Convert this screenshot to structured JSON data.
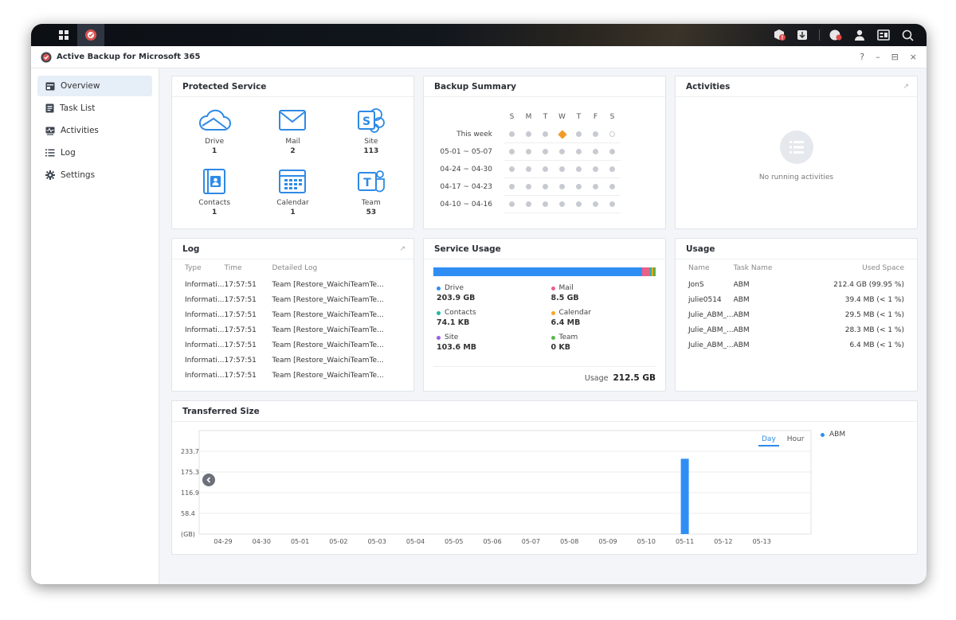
{
  "app": {
    "title": "Active Backup for Microsoft 365"
  },
  "window_controls": {
    "help": "?",
    "minimize": "–",
    "restore": "⊟",
    "close": "×"
  },
  "sidebar": {
    "items": [
      {
        "label": "Overview",
        "icon": "overview-icon"
      },
      {
        "label": "Task List",
        "icon": "task-list-icon"
      },
      {
        "label": "Activities",
        "icon": "activities-icon"
      },
      {
        "label": "Log",
        "icon": "log-icon"
      },
      {
        "label": "Settings",
        "icon": "gear-icon"
      }
    ]
  },
  "protected_service": {
    "title": "Protected Service",
    "items": [
      {
        "name": "Drive",
        "count": "1"
      },
      {
        "name": "Mail",
        "count": "2"
      },
      {
        "name": "Site",
        "count": "113"
      },
      {
        "name": "Contacts",
        "count": "1"
      },
      {
        "name": "Calendar",
        "count": "1"
      },
      {
        "name": "Team",
        "count": "53"
      }
    ]
  },
  "backup_summary": {
    "title": "Backup Summary",
    "days": [
      "S",
      "M",
      "T",
      "W",
      "T",
      "F",
      "S"
    ],
    "weeks": [
      {
        "label": "This week",
        "status": [
          "gray",
          "gray",
          "gray",
          "warning",
          "gray",
          "gray",
          "empty"
        ]
      },
      {
        "label": "05-01 ~ 05-07",
        "status": [
          "gray",
          "gray",
          "gray",
          "gray",
          "gray",
          "gray",
          "gray"
        ]
      },
      {
        "label": "04-24 ~ 04-30",
        "status": [
          "gray",
          "gray",
          "gray",
          "gray",
          "gray",
          "gray",
          "gray"
        ]
      },
      {
        "label": "04-17 ~ 04-23",
        "status": [
          "gray",
          "gray",
          "gray",
          "gray",
          "gray",
          "gray",
          "gray"
        ]
      },
      {
        "label": "04-10 ~ 04-16",
        "status": [
          "gray",
          "gray",
          "gray",
          "gray",
          "gray",
          "gray",
          "gray"
        ]
      }
    ]
  },
  "activities": {
    "title": "Activities",
    "empty_text": "No running activities"
  },
  "log": {
    "title": "Log",
    "columns": [
      "Type",
      "Time",
      "Detailed Log"
    ],
    "rows": [
      [
        "Informati...",
        "17:57:51",
        "Team [Restore_WaichiTeamTe..."
      ],
      [
        "Informati...",
        "17:57:51",
        "Team [Restore_WaichiTeamTe..."
      ],
      [
        "Informati...",
        "17:57:51",
        "Team [Restore_WaichiTeamTe..."
      ],
      [
        "Informati...",
        "17:57:51",
        "Team [Restore_WaichiTeamTe..."
      ],
      [
        "Informati...",
        "17:57:51",
        "Team [Restore_WaichiTeamTe..."
      ],
      [
        "Informati...",
        "17:57:51",
        "Team [Restore_WaichiTeamTe..."
      ],
      [
        "Informati...",
        "17:57:51",
        "Team [Restore_WaichiTeamTe..."
      ]
    ]
  },
  "service_usage": {
    "title": "Service Usage",
    "items": [
      {
        "name": "Drive",
        "value": "203.9 GB",
        "color": "#2f8ef4",
        "share": 0.9596
      },
      {
        "name": "Mail",
        "value": "8.5 GB",
        "color": "#ec5f87",
        "share": 0.04
      },
      {
        "name": "Contacts",
        "value": "74.1 KB",
        "color": "#1fb9a8",
        "share": 0.006
      },
      {
        "name": "Calendar",
        "value": "6.4 MB",
        "color": "#f5a623",
        "share": 0.006
      },
      {
        "name": "Site",
        "value": "103.6 MB",
        "color": "#9b5de5",
        "share": 0.006
      },
      {
        "name": "Team",
        "value": "0 KB",
        "color": "#58b947",
        "share": 0.006
      }
    ],
    "total_label": "Usage",
    "total_value": "212.5 GB"
  },
  "usage": {
    "title": "Usage",
    "columns": [
      "Name",
      "Task Name",
      "Used Space"
    ],
    "rows": [
      [
        "JonS",
        "ABM",
        "212.4 GB (99.95 %)"
      ],
      [
        "julie0514",
        "ABM",
        "39.4 MB (< 1 %)"
      ],
      [
        "Julie_ABM_...",
        "ABM",
        "29.5 MB (< 1 %)"
      ],
      [
        "Julie_ABM_...",
        "ABM",
        "28.3 MB (< 1 %)"
      ],
      [
        "Julie_ABM_...",
        "ABM",
        "6.4 MB (< 1 %)"
      ]
    ]
  },
  "transferred_size": {
    "title": "Transferred Size",
    "toggle": {
      "day": "Day",
      "hour": "Hour",
      "selected": "Day"
    },
    "prev_icon": "chevron-left-icon"
  },
  "chart_data": {
    "type": "bar",
    "title": "Transferred Size",
    "ylabel": "(GB)",
    "yticks": [
      "233.7",
      "175.3",
      "116.9",
      "58.4"
    ],
    "ylim": [
      0,
      292
    ],
    "categories": [
      "04-29",
      "04-30",
      "05-01",
      "05-02",
      "05-03",
      "05-04",
      "05-05",
      "05-06",
      "05-07",
      "05-08",
      "05-09",
      "05-10",
      "05-11",
      "05-12",
      "05-13"
    ],
    "series": [
      {
        "name": "ABM",
        "color": "#2f8ef4",
        "values": [
          0,
          0,
          0,
          0,
          0,
          0,
          0,
          0,
          0,
          0,
          0,
          0,
          212.5,
          0,
          0
        ]
      }
    ],
    "grid": true,
    "legend": "right"
  },
  "topbar": {
    "icons": [
      "main-menu-icon",
      "active-backup-icon",
      "package-alert-icon",
      "download-icon",
      "chat-icon",
      "user-icon",
      "widgets-icon",
      "search-icon"
    ]
  }
}
